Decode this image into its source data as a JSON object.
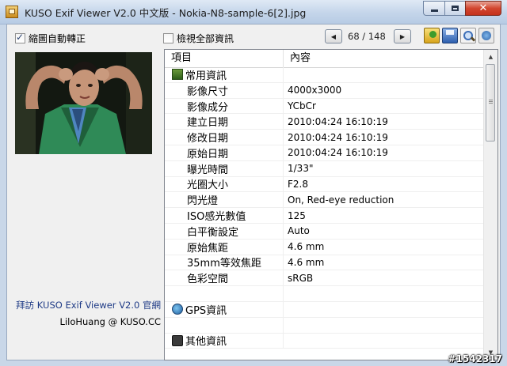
{
  "window": {
    "title": "KUSO Exif Viewer V2.0 中文版 - Nokia-N8-sample-6[2].jpg"
  },
  "toolbar": {
    "auto_rotate_label": "縮圖自動轉正",
    "auto_rotate_checked": true,
    "view_all_label": "檢視全部資訊",
    "view_all_checked": false,
    "counter": "68 / 148",
    "prev_icon": "triangle-left-icon",
    "next_icon": "triangle-right-icon",
    "icons": [
      "open-folder-icon",
      "save-icon",
      "zoom-icon",
      "web-icon"
    ]
  },
  "footer": {
    "visit_link": "拜訪 KUSO Exif Viewer V2.0 官網",
    "credit": "LiloHuang @ KUSO.CC"
  },
  "list": {
    "headers": [
      "項目",
      "內容"
    ],
    "sections": {
      "common": "常用資訊",
      "gps": "GPS資訊",
      "other": "其他資訊"
    },
    "rows": [
      {
        "key": "影像尺寸",
        "value": "4000x3000"
      },
      {
        "key": "影像成分",
        "value": "YCbCr"
      },
      {
        "key": "建立日期",
        "value": "2010:04:24 16:10:19"
      },
      {
        "key": "修改日期",
        "value": "2010:04:24 16:10:19"
      },
      {
        "key": "原始日期",
        "value": "2010:04:24 16:10:19"
      },
      {
        "key": "曝光時間",
        "value": "1/33\""
      },
      {
        "key": "光圈大小",
        "value": "F2.8"
      },
      {
        "key": "閃光燈",
        "value": "On, Red-eye reduction"
      },
      {
        "key": "ISO感光數值",
        "value": "125"
      },
      {
        "key": "白平衡設定",
        "value": "Auto"
      },
      {
        "key": "原始焦距",
        "value": "4.6 mm"
      },
      {
        "key": "35mm等效焦距",
        "value": "4.6 mm"
      },
      {
        "key": "色彩空間",
        "value": "sRGB"
      }
    ]
  },
  "watermark": "#1542317"
}
